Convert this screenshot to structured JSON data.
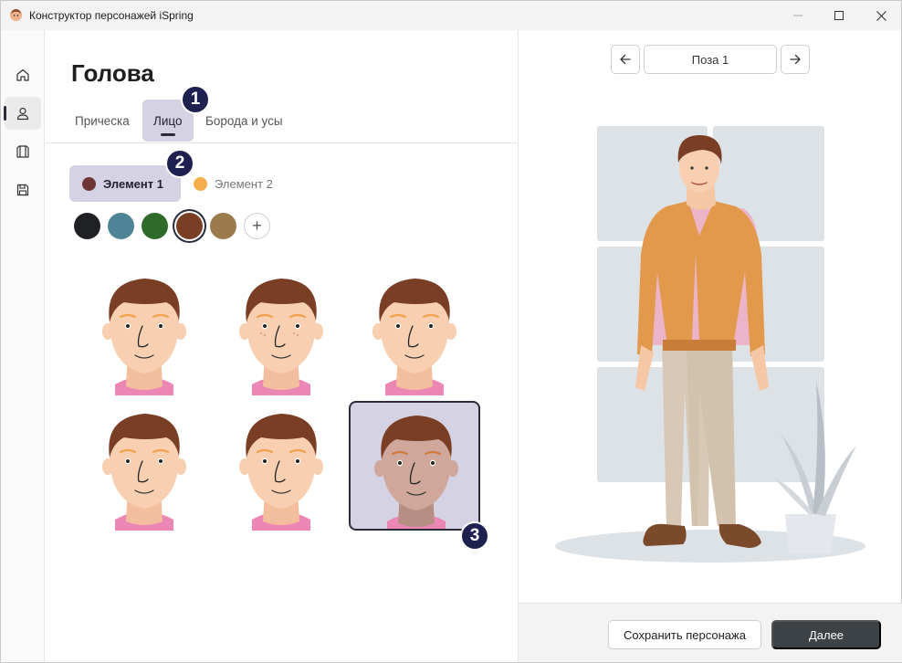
{
  "window": {
    "title": "Конструктор персонажей iSpring",
    "controls": [
      "minimize",
      "maximize",
      "close"
    ]
  },
  "sidebar": {
    "items": [
      {
        "name": "home",
        "icon": "home-icon",
        "active": false
      },
      {
        "name": "character",
        "icon": "person-icon",
        "active": true
      },
      {
        "name": "clothes",
        "icon": "shirt-icon",
        "active": false
      },
      {
        "name": "save",
        "icon": "floppy-icon",
        "active": false
      }
    ]
  },
  "main": {
    "title": "Голова",
    "tabs": [
      {
        "label": "Прическа",
        "active": false
      },
      {
        "label": "Лицо",
        "active": true
      },
      {
        "label": "Борода и усы",
        "active": false
      }
    ],
    "elements": [
      {
        "label": "Элемент 1",
        "color": "#6e3535",
        "active": true
      },
      {
        "label": "Элемент 2",
        "color": "#f6ad4b",
        "active": false
      }
    ],
    "swatches": [
      {
        "color": "#202124",
        "selected": false
      },
      {
        "color": "#4e8496",
        "selected": false
      },
      {
        "color": "#2e6b2a",
        "selected": false
      },
      {
        "color": "#7a3e24",
        "selected": true
      },
      {
        "color": "#9b7a4b",
        "selected": false
      }
    ],
    "add_swatch_label": "+",
    "faces": [
      {
        "variant": 1,
        "selected": false
      },
      {
        "variant": 2,
        "selected": false
      },
      {
        "variant": 3,
        "selected": false
      },
      {
        "variant": 4,
        "selected": false
      },
      {
        "variant": 5,
        "selected": false
      },
      {
        "variant": 6,
        "selected": true
      }
    ],
    "badges": [
      "1",
      "2",
      "3"
    ]
  },
  "preview": {
    "pose_label": "Поза 1",
    "prev_icon": "arrow-left-icon",
    "next_icon": "arrow-right-icon"
  },
  "footer": {
    "save_label": "Сохранить персонажа",
    "next_label": "Далее"
  },
  "colors": {
    "accent_selected": "#d5d3e3",
    "badge": "#1e2150",
    "primary_button": "#3d4247",
    "hair": "#7a3e24",
    "skin": "#f8cfb1",
    "cardigan": "#e2994c",
    "trousers": "#d8c8b5"
  }
}
